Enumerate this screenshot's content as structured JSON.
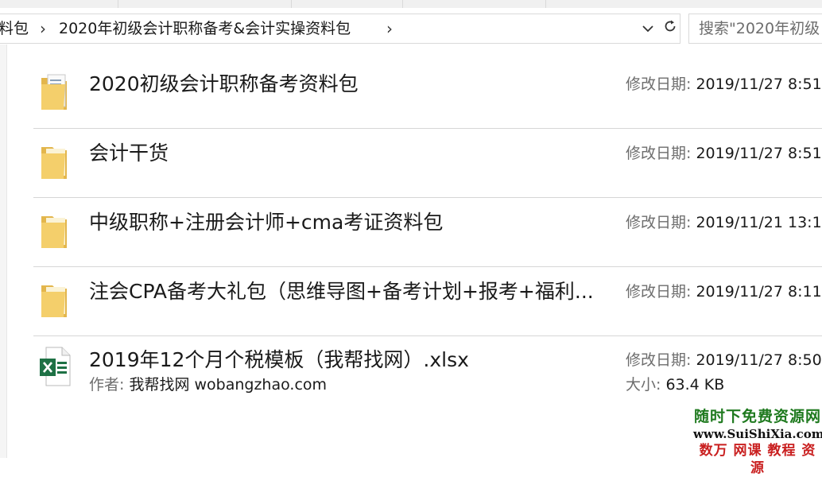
{
  "breadcrumb": {
    "items": [
      "料包",
      "2020年初级会计职称备考&会计实操资料包"
    ],
    "separator": "›"
  },
  "search": {
    "placeholder": "搜索\"2020年初级"
  },
  "rows": [
    {
      "name": "2020初级会计职称备考资料包",
      "meta_label": "修改日期:",
      "meta_value": "2019/11/27 8:51",
      "icon": "folder-with-documents-icon"
    },
    {
      "name": "会计干货",
      "meta_label": "修改日期:",
      "meta_value": "2019/11/27 8:51",
      "icon": "folder-icon"
    },
    {
      "name": "中级职称+注册会计师+cma考证资料包",
      "meta_label": "修改日期:",
      "meta_value": "2019/11/21 13:1",
      "icon": "folder-icon"
    },
    {
      "name": "注会CPA备考大礼包（思维导图+备考计划+报考+福利...",
      "meta_label": "修改日期:",
      "meta_value": "2019/11/27 8:11",
      "icon": "folder-icon"
    },
    {
      "name": "2019年12个月个税模板（我帮找网）.xlsx",
      "meta_label": "修改日期:",
      "meta_value": "2019/11/27 8:50",
      "author_label": "作者:",
      "author_value": "我帮找网 wobangzhao.com",
      "size_label": "大小:",
      "size_value": "63.4 KB",
      "icon": "excel-file-icon"
    }
  ],
  "watermark": {
    "line1": "随时下免费资源网",
    "line2": "www.SuiShiXia.com",
    "line3": "数万 网课 教程 资源"
  },
  "colors": {
    "divider": "#d6d6d6",
    "label_gray": "#6d6d6d",
    "folder_yellow": "#f4cf6b",
    "excel_green": "#1e7145"
  }
}
